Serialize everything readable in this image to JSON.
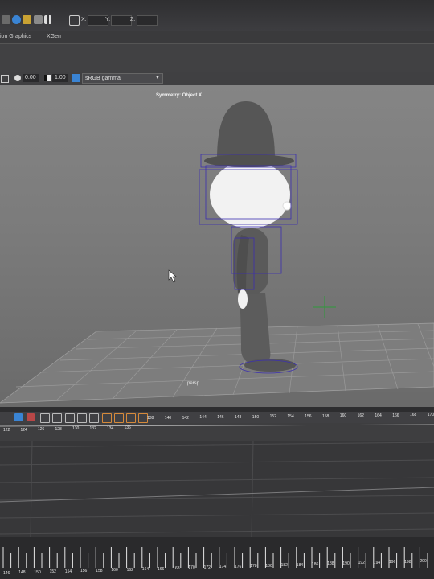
{
  "toolbar": {
    "coords": [
      {
        "label": "X:"
      },
      {
        "label": "Y:"
      },
      {
        "label": "Z:"
      }
    ]
  },
  "menu": {
    "tabs": [
      "ion Graphics",
      "XGen"
    ]
  },
  "viewport_toolbar": {
    "exposure": "0.00",
    "gamma": "1.00",
    "color_space": "sRGB gamma"
  },
  "viewport": {
    "symmetry_label": "Symmetry: Object X",
    "camera_label": "persp"
  },
  "timeline": {
    "upper_ruler_top": [
      "138",
      "140",
      "142",
      "144",
      "146",
      "148",
      "150",
      "152",
      "154",
      "156",
      "158",
      "160",
      "162",
      "164",
      "166",
      "168",
      "170"
    ],
    "upper_ruler_mid": [
      "122",
      "124",
      "126",
      "128",
      "130",
      "132",
      "134",
      "136"
    ],
    "lower_ruler": [
      "146",
      "148",
      "150",
      "152",
      "154",
      "156",
      "158",
      "160",
      "162",
      "164",
      "166",
      "168",
      "170",
      "172",
      "174",
      "176",
      "178",
      "180",
      "182",
      "184",
      "186",
      "188",
      "190",
      "192",
      "194",
      "196",
      "198",
      "200"
    ]
  },
  "colors": {
    "viewport_bg": "#7b7b7b",
    "grid": "#9a9a9a",
    "character_body": "#5c5c5c",
    "character_head": "#f2f2f2",
    "selection_box": "#3b2fb0",
    "pivot_marker": "#2e9a3a",
    "timeline_bg": "#3e3e40",
    "accent_blue": "#3a84d4"
  }
}
